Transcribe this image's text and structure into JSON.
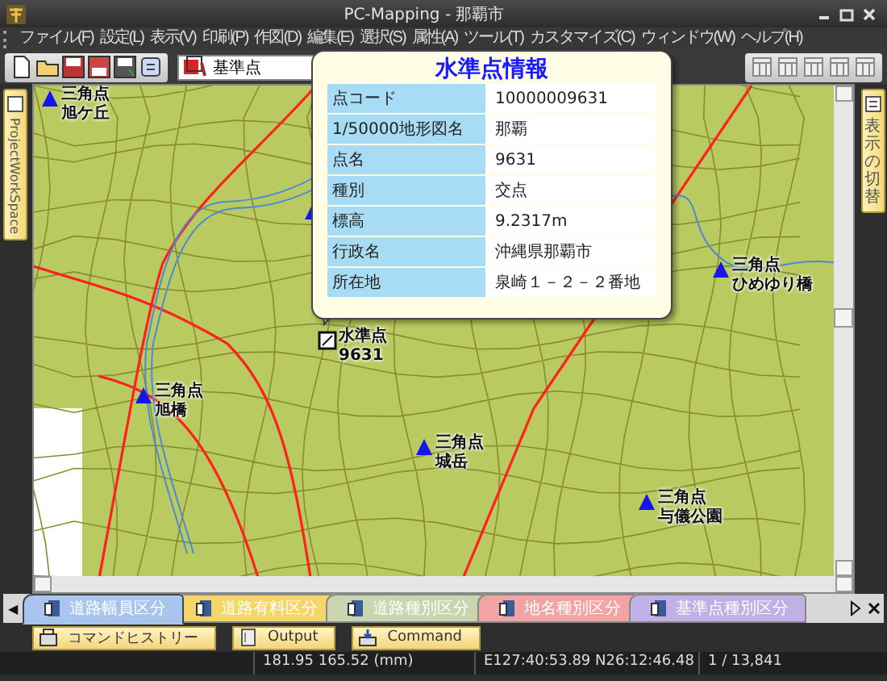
{
  "window": {
    "title": "PC-Mapping - 那覇市"
  },
  "menu": [
    "ファイル(F)",
    "設定(L)",
    "表示(V)",
    "印刷(P)",
    "作図(D)",
    "編集(E)",
    "選択(S)",
    "属性(A)",
    "ツール(T)",
    "カスタマイズ(C)",
    "ウィンドウ(W)",
    "ヘルプ(H)"
  ],
  "toolbar": {
    "layer_select": "基準点"
  },
  "left_panel": {
    "label": "ProjectWorkSpace"
  },
  "right_panel": {
    "label": "表示の切替"
  },
  "map": {
    "points": [
      {
        "kind": "triangle",
        "type": "三角点",
        "name": "旭ケ丘"
      },
      {
        "kind": "triangle",
        "type": "三角点",
        "name": "旭橋"
      },
      {
        "kind": "triangle",
        "type": "三角点",
        "name": "城岳"
      },
      {
        "kind": "benchmark",
        "type": "水準点",
        "name": "9631"
      },
      {
        "kind": "triangle",
        "type": "三角点",
        "name": "ひめゆり橋"
      },
      {
        "kind": "triangle",
        "type": "三角点",
        "name": "与儀公園"
      }
    ]
  },
  "info_popup": {
    "title": "水準点情報",
    "rows": [
      {
        "key": "点コード",
        "value": "10000009631"
      },
      {
        "key": "1/50000地形図名",
        "value": "那覇"
      },
      {
        "key": "点名",
        "value": "9631"
      },
      {
        "key": "種別",
        "value": "交点"
      },
      {
        "key": "標高",
        "value": "9.2317m"
      },
      {
        "key": "行政名",
        "value": "沖縄県那覇市"
      },
      {
        "key": "所在地",
        "value": "泉崎１－２－２番地"
      }
    ]
  },
  "layer_tabs_scroll_left": "◀",
  "layer_tabs": [
    {
      "label": "道路幅員区分",
      "color": "#a9c5ee",
      "selected": true
    },
    {
      "label": "道路有料区分",
      "color": "#f3d56a",
      "selected": false
    },
    {
      "label": "道路種別区分",
      "color": "#c8d5ae",
      "selected": false
    },
    {
      "label": "地名種別区分",
      "color": "#f2a3a3",
      "selected": false
    },
    {
      "label": "基準点種別区分",
      "color": "#c0b0e6",
      "selected": false
    }
  ],
  "panes": [
    "コマンドヒストリー",
    "Output",
    "Command"
  ],
  "status_bar": [
    "181.95 165.52 (mm)",
    "E127:40:53.89 N26:12:46.48",
    "1 / 13,841"
  ]
}
